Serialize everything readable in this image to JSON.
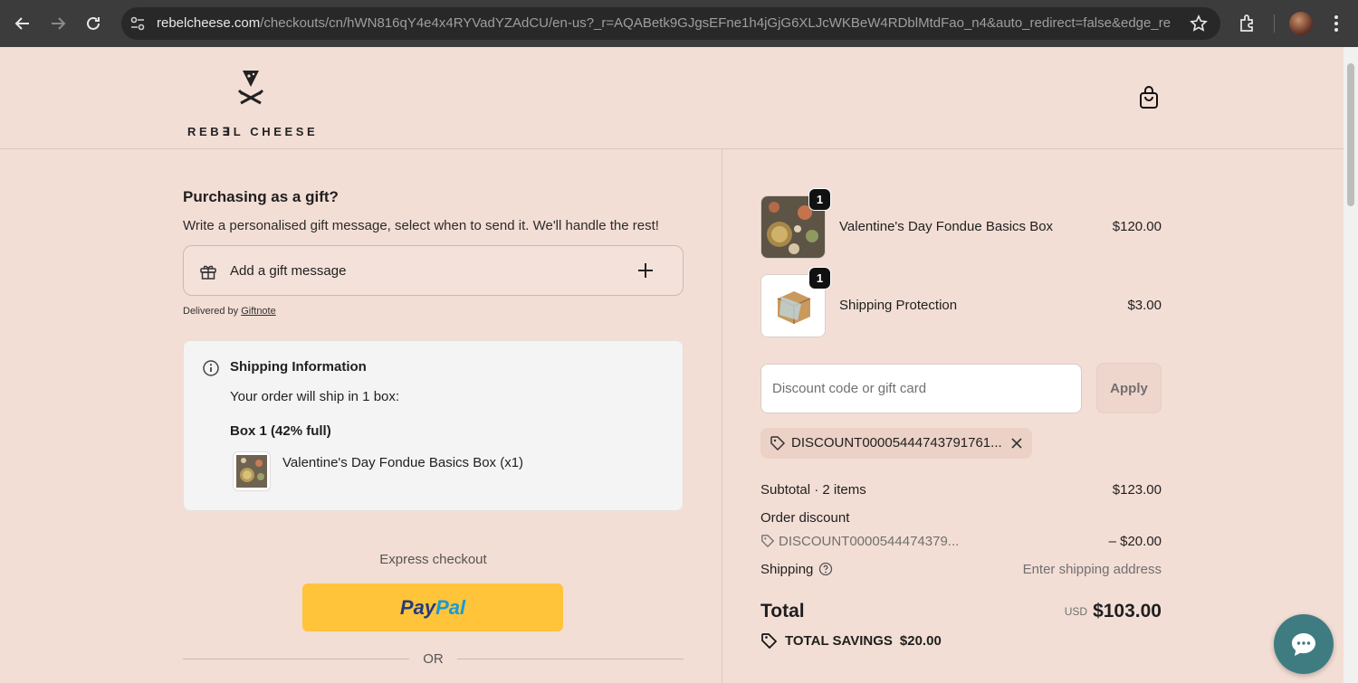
{
  "browser": {
    "url_host": "rebelcheese.com",
    "url_rest": "/checkouts/cn/hWN816qY4e4x4RYVadYZAdCU/en-us?_r=AQABetk9GJgsEFne1h4jGjG6XLJcWKBeW4RDblMtdFao_n4&auto_redirect=false&edge_re..."
  },
  "header": {
    "logo_text": "REB∃L CHEESE"
  },
  "gift": {
    "title": "Purchasing as a gift?",
    "subtitle": "Write a personalised gift message, select when to send it. We'll handle the rest!",
    "add_label": "Add a gift message",
    "delivered_by": "Delivered by",
    "delivered_link": "Giftnote"
  },
  "shipping_info": {
    "title": "Shipping Information",
    "line": "Your order will ship in 1 box:",
    "box_label": "Box 1 (42% full)",
    "item": "Valentine's Day Fondue Basics Box (x1)"
  },
  "express": {
    "label": "Express checkout",
    "paypal_1": "Pay",
    "paypal_2": "Pal",
    "or_label": "OR"
  },
  "cart": {
    "items": [
      {
        "name": "Valentine's Day Fondue Basics Box",
        "price": "$120.00",
        "qty": "1"
      },
      {
        "name": "Shipping Protection",
        "price": "$3.00",
        "qty": "1"
      }
    ],
    "discount_placeholder": "Discount code or gift card",
    "apply_label": "Apply",
    "applied_code": "DISCOUNT00005444743791761...",
    "subtotal_label": "Subtotal · 2 items",
    "subtotal_value": "$123.00",
    "order_discount_label": "Order discount",
    "order_discount_code": "DISCOUNT0000544474379...",
    "order_discount_value": "– $20.00",
    "shipping_label": "Shipping",
    "shipping_value": "Enter shipping address",
    "total_label": "Total",
    "total_currency": "USD",
    "total_value": "$103.00",
    "savings_label": "TOTAL SAVINGS",
    "savings_value": "$20.00"
  },
  "colors": {
    "page_bg": "#f3ded5",
    "paypal_yellow": "#ffc439",
    "chat_teal": "#3e7c82"
  }
}
